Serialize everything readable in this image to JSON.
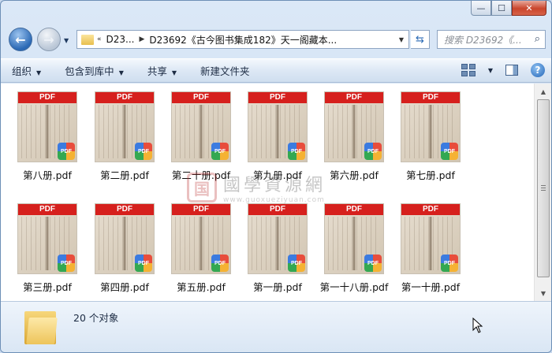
{
  "window": {
    "caption": {
      "minimize": "—",
      "maximize": "☐",
      "close": "✕"
    }
  },
  "address": {
    "overflow": "«",
    "segments": [
      "D23...",
      "D23692《古今图书集成182》天一阁藏本..."
    ],
    "search_placeholder": "搜索 D23692《..."
  },
  "toolbar": {
    "organize": "组织",
    "include_library": "包含到库中",
    "share": "共享",
    "new_folder": "新建文件夹"
  },
  "files": [
    {
      "name": "第八册.pdf"
    },
    {
      "name": "第二册.pdf"
    },
    {
      "name": "第二十册.pdf"
    },
    {
      "name": "第九册.pdf"
    },
    {
      "name": "第六册.pdf"
    },
    {
      "name": "第七册.pdf"
    },
    {
      "name": "第三册.pdf"
    },
    {
      "name": "第四册.pdf"
    },
    {
      "name": "第五册.pdf"
    },
    {
      "name": "第一册.pdf"
    },
    {
      "name": "第一十八册.pdf"
    },
    {
      "name": "第一十册.pdf"
    }
  ],
  "file_badge": {
    "band": "PDF",
    "badge": "PDF"
  },
  "watermark": {
    "seal": "国",
    "title": "國學資源網",
    "url": "www.guoxueziyuan.com"
  },
  "status": {
    "count": "20 个对象"
  },
  "colors": {
    "pdf_red": "#d6201d",
    "accent": "#2b69b5"
  }
}
